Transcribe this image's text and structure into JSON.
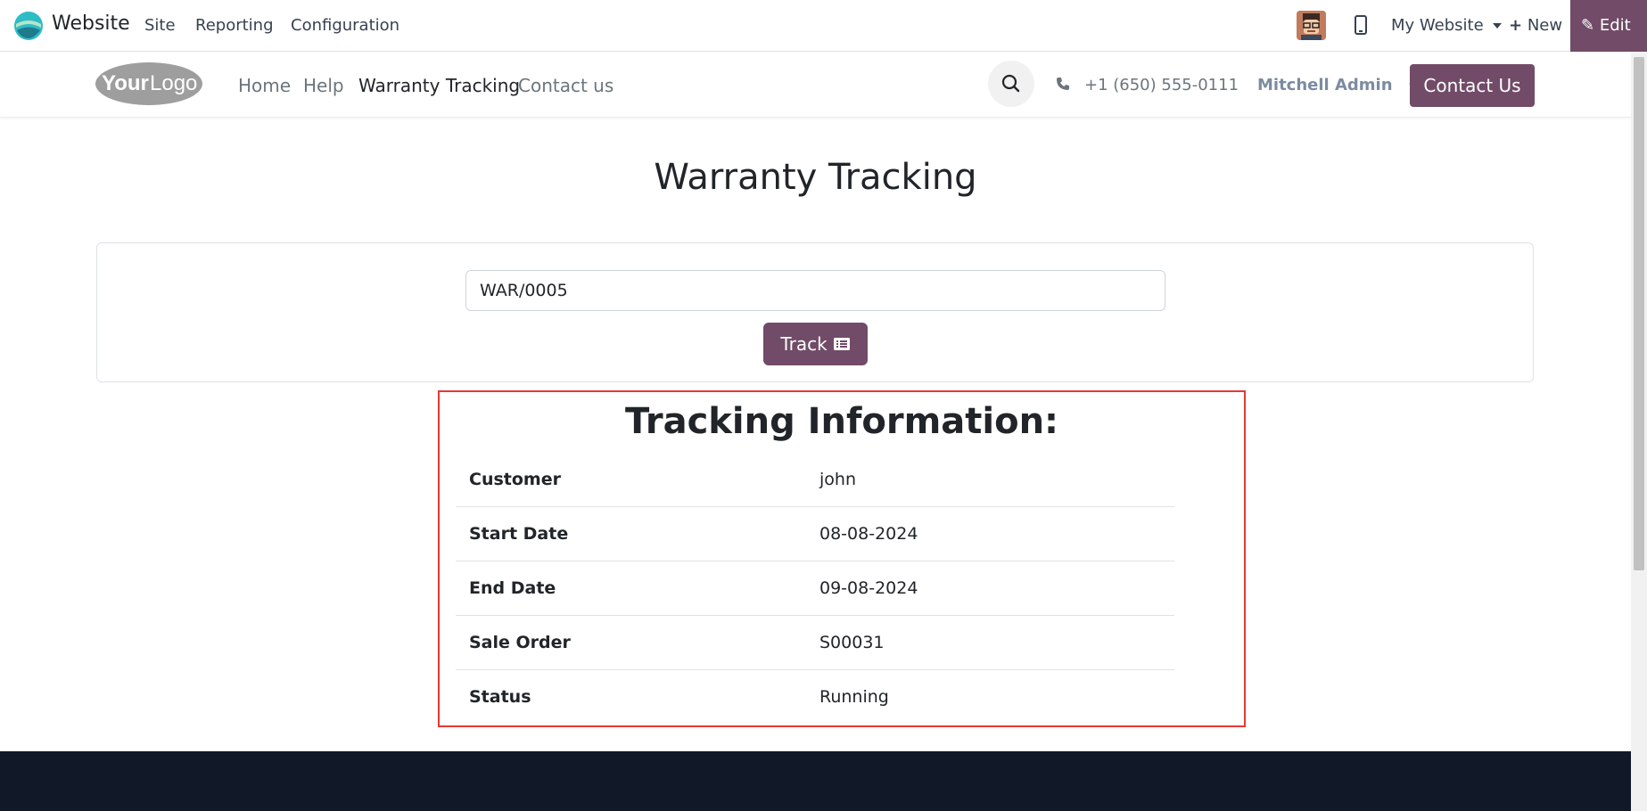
{
  "admin_bar": {
    "app_name": "Website",
    "menus": [
      "Site",
      "Reporting",
      "Configuration"
    ],
    "site_switcher": "My Website",
    "new_label": "New",
    "edit_label": "Edit"
  },
  "header": {
    "logo_text": "YourLogo",
    "nav": [
      "Home",
      "Help",
      "Warranty Tracking",
      "Contact us"
    ],
    "active_nav": "Warranty Tracking",
    "phone": "+1 (650) 555-0111",
    "user": "Mitchell Admin",
    "contact_button": "Contact Us"
  },
  "main": {
    "title": "Warranty Tracking",
    "search_value": "WAR/0005",
    "track_button": "Track",
    "info_title": "Tracking Information:",
    "rows": [
      {
        "label": "Customer",
        "value": "john"
      },
      {
        "label": "Start Date",
        "value": "08-08-2024"
      },
      {
        "label": "End Date",
        "value": "09-08-2024"
      },
      {
        "label": "Sale Order",
        "value": "S00031"
      },
      {
        "label": "Status",
        "value": "Running"
      }
    ]
  },
  "colors": {
    "brand": "#714b67",
    "highlight_border": "#e53935",
    "footer": "#111827"
  }
}
